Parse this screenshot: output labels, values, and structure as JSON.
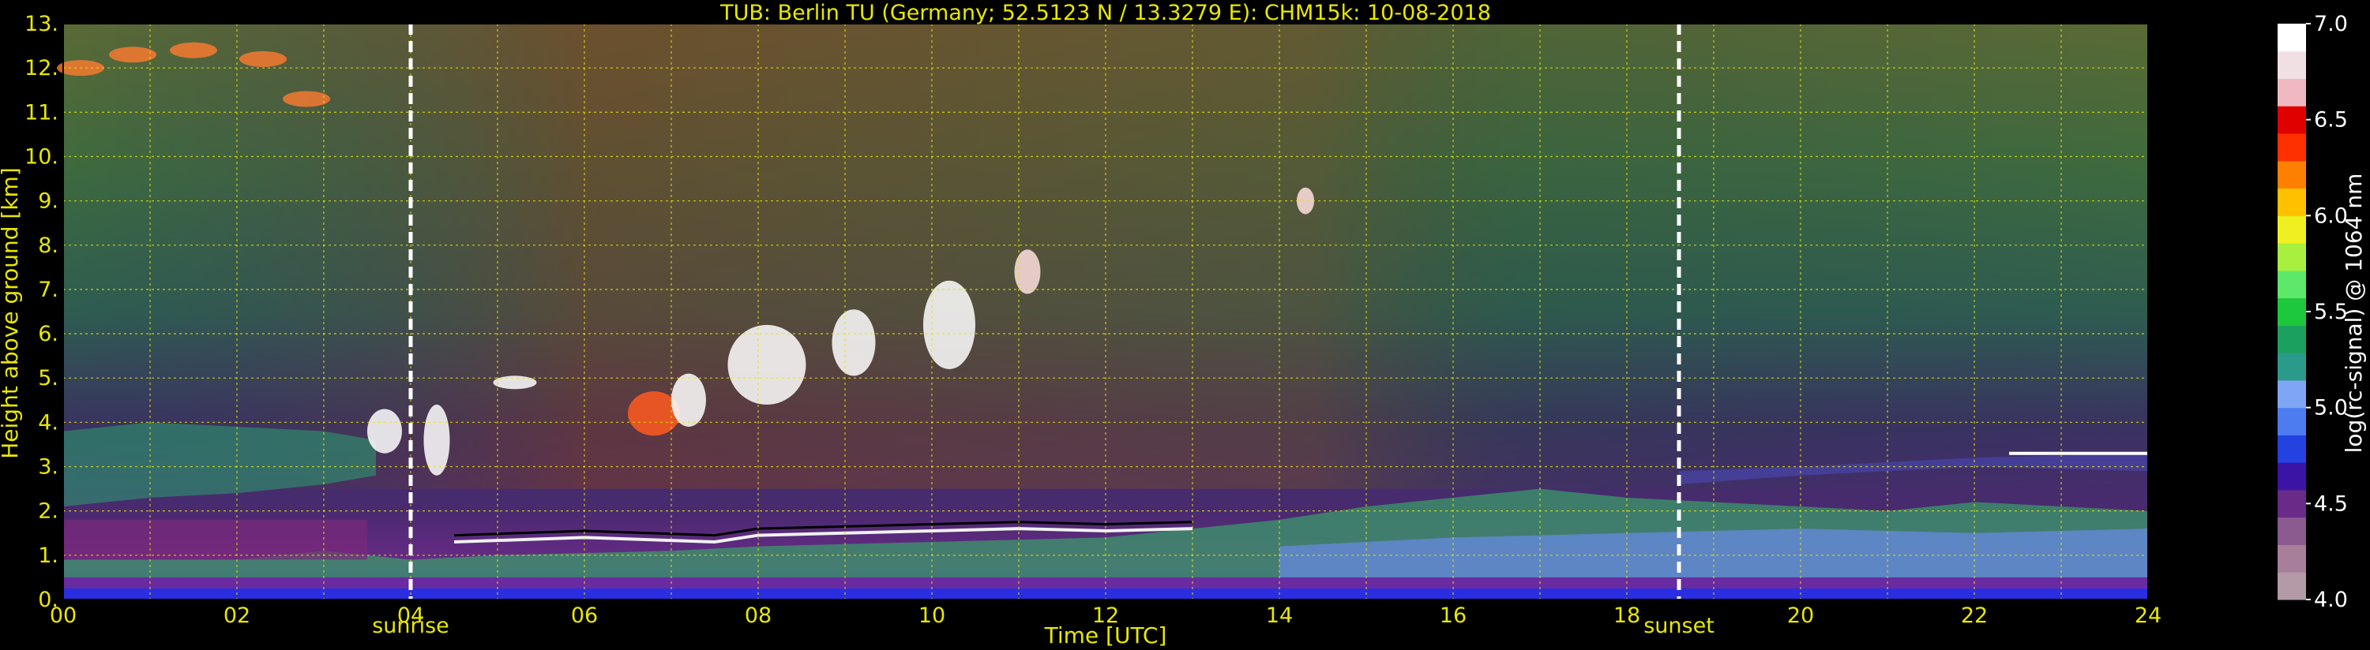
{
  "chart_data": {
    "type": "heatmap",
    "title": "TUB: Berlin TU (Germany; 52.5123 N / 13.3279 E):    CHM15k: 10-08-2018",
    "xlabel": "Time [UTC]",
    "ylabel": "Height above ground [km]",
    "xlim": [
      0,
      24
    ],
    "ylim": [
      0,
      13
    ],
    "x_ticks": [
      "00",
      "02",
      "04",
      "06",
      "08",
      "10",
      "12",
      "14",
      "16",
      "18",
      "20",
      "22",
      "24"
    ],
    "y_ticks": [
      "0.",
      "1.",
      "2.",
      "3.",
      "4.",
      "5.",
      "6.",
      "7.",
      "8.",
      "9.",
      "10.",
      "11.",
      "12.",
      "13."
    ],
    "grid": true,
    "events": [
      {
        "label": "sunrise",
        "time": 4.0
      },
      {
        "label": "sunset",
        "time": 18.6
      }
    ],
    "colorbar": {
      "label": "log(rc-signal) @ 1064 nm",
      "range": [
        4.0,
        7.0
      ],
      "ticks": [
        "4.0",
        "4.5",
        "5.0",
        "5.5",
        "6.0",
        "6.5",
        "7.0"
      ],
      "colors": [
        "#b49aa6",
        "#a77f9a",
        "#8b5a8e",
        "#6a2a88",
        "#3b14a6",
        "#2442e0",
        "#4d7cf0",
        "#7fa6f4",
        "#2a9a8a",
        "#1ca060",
        "#1ec83c",
        "#5ee86a",
        "#a8f040",
        "#f0f020",
        "#ffc000",
        "#ff8000",
        "#ff3000",
        "#e00000",
        "#f0b8c0",
        "#f0e0e4",
        "#ffffff"
      ]
    },
    "layers": [
      {
        "name": "boundary layer",
        "approx_top_km": [
          0.9,
          2.6
        ]
      },
      {
        "name": "residual/aerosol layer",
        "approx_top_km": [
          2.0,
          4.2
        ]
      },
      {
        "name": "clouds",
        "approx_height_km": [
          3.5,
          8.5
        ],
        "time_range": [
          3.5,
          11.5
        ]
      },
      {
        "name": "cirrus",
        "approx_height_km": [
          11.2,
          12.6
        ],
        "time_range": [
          0.0,
          2.8
        ]
      }
    ]
  }
}
